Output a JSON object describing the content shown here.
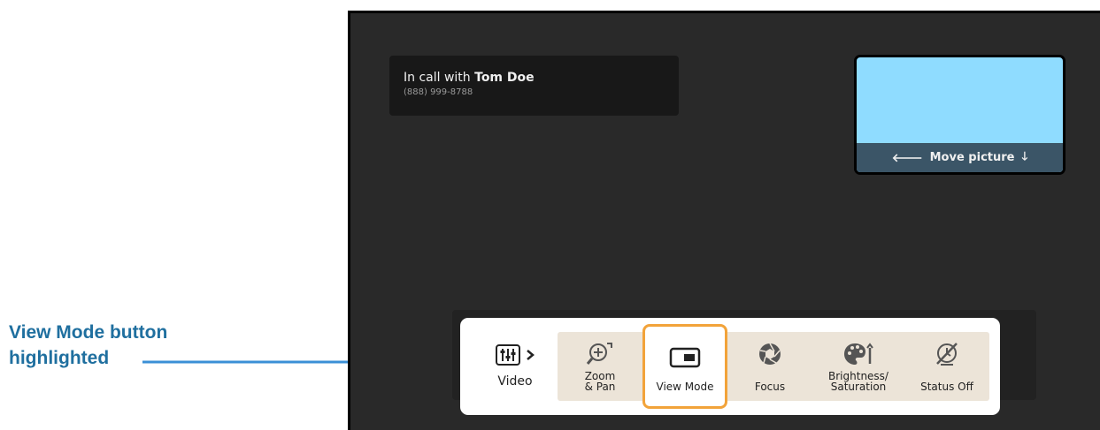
{
  "callout": {
    "line1": "View Mode button",
    "line2": "highlighted"
  },
  "call": {
    "prefix": "In call with ",
    "name": "Tom Doe",
    "number": "(888) 999-8788"
  },
  "pip": {
    "move_label": "Move picture",
    "left_arrow_icon": "arrow-left-icon",
    "down_arrow_icon": "arrow-down-icon"
  },
  "toolbar": {
    "video_label": "Video",
    "buttons": [
      {
        "label_line1": "Zoom",
        "label_line2": "& Pan",
        "icon": "zoom-pan-icon"
      },
      {
        "label_line1": "View Mode",
        "label_line2": "",
        "icon": "view-mode-icon",
        "active": true
      },
      {
        "label_line1": "Focus",
        "label_line2": "",
        "icon": "aperture-icon"
      },
      {
        "label_line1": "Brightness/",
        "label_line2": "Saturation",
        "icon": "palette-icon"
      },
      {
        "label_line1": "Status Off",
        "label_line2": "",
        "icon": "status-off-icon"
      }
    ]
  },
  "colors": {
    "callout_text": "#1f6f9f",
    "pointer": "#3a8fd6",
    "screen_bg": "#292929",
    "pip_video": "#8fdcff",
    "pip_bar": "#3b5567",
    "toolbar_group": "#ece4d8",
    "highlight_border": "#f2a33a"
  }
}
